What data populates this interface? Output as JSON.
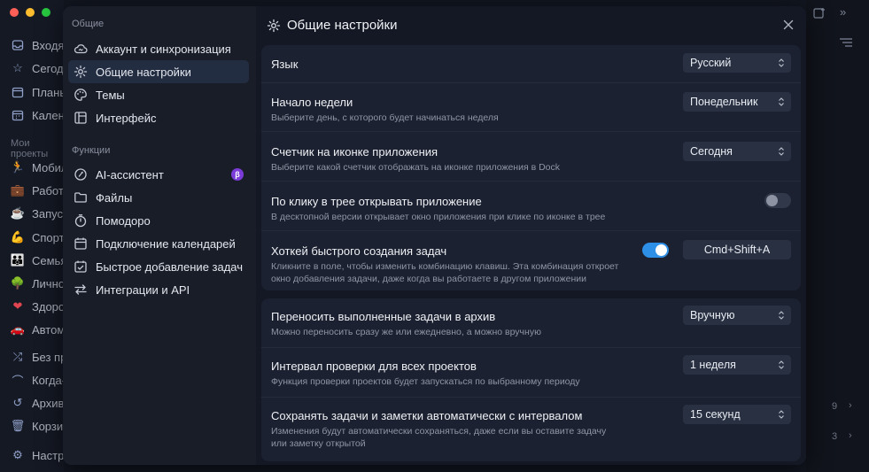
{
  "background": {
    "sidebar_items": [
      {
        "label": "Входя",
        "icon": "inbox-icon"
      },
      {
        "label": "Сегод",
        "icon": "star-icon"
      },
      {
        "label": "Планы",
        "icon": "calendar-icon"
      },
      {
        "label": "Кален",
        "icon": "calendar-grid-icon"
      }
    ],
    "projects_section": "Мои проекты",
    "projects": [
      {
        "label": "Мобил",
        "icon": "runner-icon"
      },
      {
        "label": "Работа",
        "icon": "briefcase-icon"
      },
      {
        "label": "Запус",
        "icon": "cup-icon"
      },
      {
        "label": "Спорт",
        "icon": "muscle-icon"
      },
      {
        "label": "Семья",
        "icon": "family-icon"
      },
      {
        "label": "Лично",
        "icon": "tree-icon"
      },
      {
        "label": "Здоро",
        "icon": "heart-icon"
      },
      {
        "label": "Автом",
        "icon": "car-icon"
      }
    ],
    "misc": [
      {
        "label": "Без пр",
        "icon": "shuffle-icon"
      },
      {
        "label": "Когда-",
        "icon": "rainbow-icon"
      },
      {
        "label": "Архив",
        "icon": "history-icon"
      },
      {
        "label": "Корзи",
        "icon": "trash-icon"
      },
      {
        "label": "Настр",
        "icon": "gear-icon"
      }
    ],
    "counts": [
      "9",
      "3"
    ]
  },
  "nav": {
    "section_general": "Общие",
    "general_items": [
      {
        "label": "Аккаунт и синхронизация",
        "icon": "cloud-icon"
      },
      {
        "label": "Общие настройки",
        "icon": "gear-icon"
      },
      {
        "label": "Темы",
        "icon": "palette-icon"
      },
      {
        "label": "Интерфейс",
        "icon": "interface-icon"
      }
    ],
    "section_features": "Функции",
    "feature_items": [
      {
        "label": "AI-ассистент",
        "icon": "ai-icon",
        "badge": "β"
      },
      {
        "label": "Файлы",
        "icon": "folder-icon"
      },
      {
        "label": "Помодоро",
        "icon": "timer-icon"
      },
      {
        "label": "Подключение календарей",
        "icon": "calendar-icon"
      },
      {
        "label": "Быстрое добавление задач",
        "icon": "quick-add-icon"
      },
      {
        "label": "Интеграции и API",
        "icon": "arrows-icon"
      }
    ]
  },
  "content": {
    "title": "Общие настройки",
    "settings": {
      "language": {
        "title": "Язык",
        "value": "Русский"
      },
      "week_start": {
        "title": "Начало недели",
        "desc": "Выберите день, с которого будет начинаться неделя",
        "value": "Понедельник"
      },
      "badge_counter": {
        "title": "Счетчик на иконке приложения",
        "desc": "Выберите какой счетчик отображать на иконке приложения в Dock",
        "value": "Сегодня"
      },
      "tray_open": {
        "title": "По клику в трее открывать приложение",
        "desc": "В десктопной версии открывает окно приложения при клике по иконке в трее",
        "enabled": false
      },
      "hotkey": {
        "title": "Хоткей быстрого создания задач",
        "desc": "Кликните в поле, чтобы изменить комбинацию клавиш. Эта комбинация откроет окно добавления задачи, даже когда вы работаете в другом приложении",
        "enabled": true,
        "value": "Cmd+Shift+A"
      },
      "archive": {
        "title": "Переносить выполненные задачи в архив",
        "desc": "Можно переносить сразу же или ежедневно, а можно вручную",
        "value": "Вручную"
      },
      "check_interval": {
        "title": "Интервал проверки для всех проектов",
        "desc": "Функция проверки проектов будет запускаться по выбранному периоду",
        "value": "1 неделя"
      },
      "autosave": {
        "title": "Сохранять задачи и заметки автоматически с интервалом",
        "desc": "Изменения будут автоматически сохраняться, даже если вы оставите задачу или заметку открытой",
        "value": "15 секунд"
      }
    }
  },
  "colors": {
    "accent": "#2d8fe6",
    "active_nav": "#232d42",
    "beta": "#7a3bd8"
  }
}
